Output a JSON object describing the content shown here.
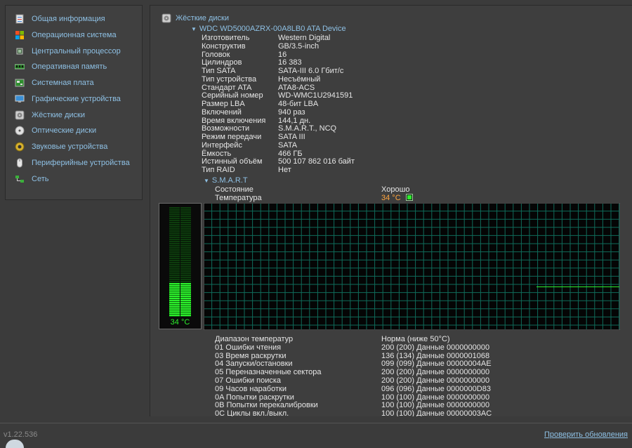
{
  "sidebar": {
    "items": [
      {
        "label": "Общая информация",
        "icon": "summary-icon"
      },
      {
        "label": "Операционная система",
        "icon": "windows-icon"
      },
      {
        "label": "Центральный процессор",
        "icon": "cpu-icon"
      },
      {
        "label": "Оперативная память",
        "icon": "ram-icon"
      },
      {
        "label": "Системная плата",
        "icon": "motherboard-icon"
      },
      {
        "label": "Графические устройства",
        "icon": "monitor-icon"
      },
      {
        "label": "Жёсткие диски",
        "icon": "hdd-icon"
      },
      {
        "label": "Оптические диски",
        "icon": "optical-disc-icon"
      },
      {
        "label": "Звуковые устройства",
        "icon": "speaker-icon"
      },
      {
        "label": "Периферийные устройства",
        "icon": "mouse-icon"
      },
      {
        "label": "Сеть",
        "icon": "network-icon"
      }
    ]
  },
  "main": {
    "section_title": "Жёсткие диски",
    "device_name": "WDC WD5000AZRX-00A8LB0 ATA Device",
    "properties": [
      {
        "k": "Изготовитель",
        "v": "Western Digital"
      },
      {
        "k": "Конструктив",
        "v": "GB/3.5-inch"
      },
      {
        "k": "Головок",
        "v": "16"
      },
      {
        "k": "Цилиндров",
        "v": "16 383"
      },
      {
        "k": "Тип SATA",
        "v": "SATA-III 6.0 Гбит/с"
      },
      {
        "k": "Тип устройства",
        "v": "Несъёмный"
      },
      {
        "k": "Стандарт ATA",
        "v": "ATA8-ACS"
      },
      {
        "k": "Серийный номер",
        "v": "WD-WMC1U2941591"
      },
      {
        "k": "Размер LBA",
        "v": "48-бит LBA"
      },
      {
        "k": "Включений",
        "v": "940 раз"
      },
      {
        "k": "Время включения",
        "v": "144,1 дн."
      },
      {
        "k": "Возможности",
        "v": "S.M.A.R.T., NCQ"
      },
      {
        "k": "Режим передачи",
        "v": "SATA III"
      },
      {
        "k": "Интерфейс",
        "v": "SATA"
      },
      {
        "k": "Ёмкость",
        "v": "466 ГБ"
      },
      {
        "k": "Истинный объём",
        "v": "500 107 862 016 байт"
      },
      {
        "k": "Тип RAID",
        "v": "Нет"
      }
    ],
    "smart": {
      "title": "S.M.A.R.T",
      "status_label": "Состояние",
      "status_value": "Хорошо",
      "temp_label": "Температура",
      "temp_value": "34 °C",
      "temp_fill_fraction": 0.31,
      "graph_color": "#2cf02c",
      "graph_line_value_fraction": 0.34,
      "attributes": [
        {
          "k": "Диапазон температур",
          "v": "Норма (ниже 50°C)"
        },
        {
          "k": "01 Ошибки чтения",
          "v": "200 (200) Данные 0000000000"
        },
        {
          "k": "03 Время раскрутки",
          "v": "136 (134) Данные 0000001068"
        },
        {
          "k": "04 Запуски/остановки",
          "v": "099 (099) Данные 00000004AE"
        },
        {
          "k": "05 Переназначенные сектора",
          "v": "200 (200) Данные 0000000000"
        },
        {
          "k": "07 Ошибки поиска",
          "v": "200 (200) Данные 0000000000"
        },
        {
          "k": "09 Часов наработки",
          "v": "096 (096) Данные 0000000D83"
        },
        {
          "k": "0A Попытки раскрутки",
          "v": "100 (100) Данные 0000000000"
        },
        {
          "k": "0B Попытки перекалибровки",
          "v": "100 (100) Данные 0000000000"
        },
        {
          "k": "0C Циклы вкл./выкл.",
          "v": "100 (100) Данные 00000003AC"
        }
      ]
    }
  },
  "footer": {
    "version": "v1.22.536",
    "update_link": "Проверить обновления"
  }
}
